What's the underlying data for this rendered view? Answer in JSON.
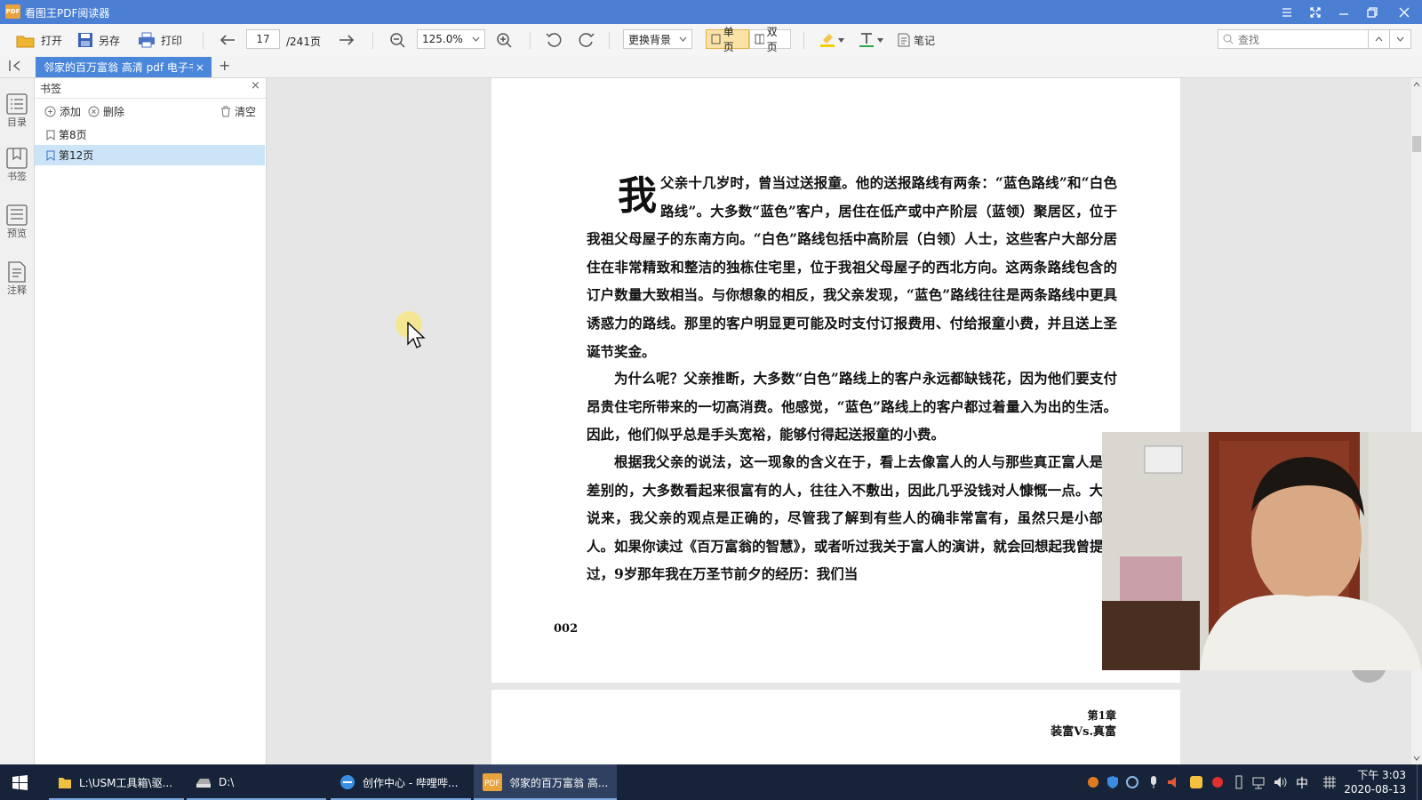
{
  "app": {
    "title": "看图王PDF阅读器",
    "logo_text": "PDF"
  },
  "toolbar": {
    "open": "打开",
    "save_as": "另存",
    "print": "打印",
    "page_value": "17",
    "page_total": "/241页",
    "zoom_value": "125.0%",
    "background": "更换背景",
    "single_page": "单页",
    "double_page": "双页",
    "notes": "笔记",
    "search_placeholder": "查找"
  },
  "tabs": {
    "doc_tab": "邻家的百万富翁 高清 pdf 电子书",
    "close": "×",
    "add": "+"
  },
  "left_strip": [
    {
      "label": "目录",
      "icon": "toc-icon"
    },
    {
      "label": "书签",
      "icon": "bookmark-icon"
    },
    {
      "label": "预览",
      "icon": "preview-icon"
    },
    {
      "label": "注释",
      "icon": "annotation-icon"
    }
  ],
  "bookmarks": {
    "header": "书签",
    "close": "×",
    "add": "添加",
    "delete": "删除",
    "clear": "清空",
    "items": [
      {
        "label": "第8页"
      },
      {
        "label": "第12页",
        "selected": true
      }
    ]
  },
  "page": {
    "dropcap": "我",
    "p1": "父亲十几岁时，曾当过送报童。他的送报路线有两条：“蓝色路线”和“白色路线”。大多数“蓝色”客户，居住在低产或中产阶层（蓝领）聚居区，位于我祖父母屋子的东南方向。“白色”路线包括中高阶层（白领）人士，这些客户大部分居住在非常精致和整洁的独栋住宅里，位于我祖父母屋子的西北方向。这两条路线包含的订户数量大致相当。与你想象的相反，我父亲发现，“蓝色”路线往往是两条路线中更具诱惑力的路线。那里的客户明显更可能及时支付订报费用、付给报童小费，并且送上圣诞节奖金。",
    "p2": "为什么呢？父亲推断，大多数“白色”路线上的客户永远都缺钱花，因为他们要支付昂贵住宅所带来的一切高消费。他感觉，“蓝色”路线上的客户都过着量入为出的生活。因此，他们似乎总是手头宽裕，能够付得起送报童的小费。",
    "p3": "根据我父亲的说法，这一现象的含义在于，看上去像富人的人与那些真正富人是有差别的，大多数看起来很富有的人，往往入不敷出，因此几乎没钱对人慷慨一点。大体说来，我父亲的观点是正确的，尽管我了解到有些人的确非常富有，虽然只是小部分人。如果你读过《百万富翁的智慧》，或者听过我关于富人的演讲，就会回想起我曾提到过，9岁那年我在万圣节前夕的经历：我们当",
    "page_number": "002",
    "next_chapter": "第1章",
    "next_title": "装富Vs.真富"
  },
  "taskbar": {
    "items": [
      {
        "label": "L:\\USM工具箱\\驱..."
      },
      {
        "label": "D:\\"
      },
      {
        "label": "创作中心 - 哔哩哔..."
      },
      {
        "label": "邻家的百万富翁 高..."
      }
    ],
    "ime": "中",
    "time": "下午 3:03",
    "date": "2020-08-13"
  },
  "colors": {
    "titlebar": "#4a7fd4",
    "tab_active": "#4a86d9",
    "bookmark_selected": "#cce4f7",
    "taskbar": "#162338"
  }
}
